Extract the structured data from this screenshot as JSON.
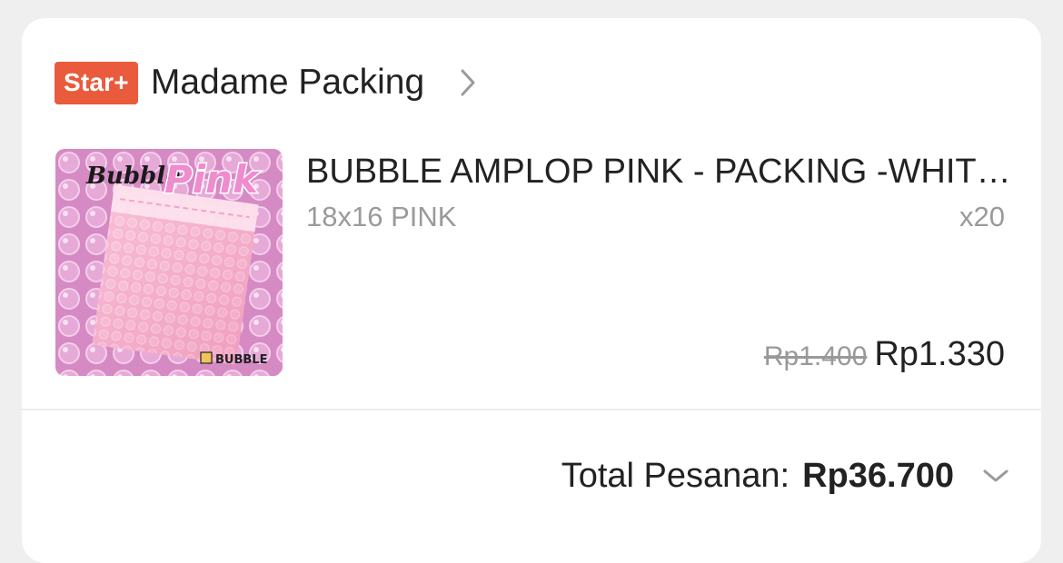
{
  "shop": {
    "badge": "Star+",
    "name": "Madame Packing"
  },
  "product": {
    "title": "BUBBLE AMPLOP PINK - PACKING -WHITE BUBBLE WRAP MAILER",
    "variant": "18x16 PINK",
    "quantity": "x20",
    "original_price": "Rp1.400",
    "price": "Rp1.330",
    "image": {
      "script_word": "Bubble",
      "big_word": "Pink",
      "brand": "BUBBLE"
    }
  },
  "order": {
    "total_label": "Total Pesanan:",
    "total_value": "Rp36.700"
  },
  "colors": {
    "badge_bg": "#ea5a3c",
    "card_bg": "#ffffff",
    "page_bg": "#efefef",
    "image_bg": "#d98dc6",
    "envelope": "#f4a9c6"
  },
  "icons": {
    "shop_chevron": "chevron-right-icon",
    "total_chevron": "chevron-down-icon"
  }
}
